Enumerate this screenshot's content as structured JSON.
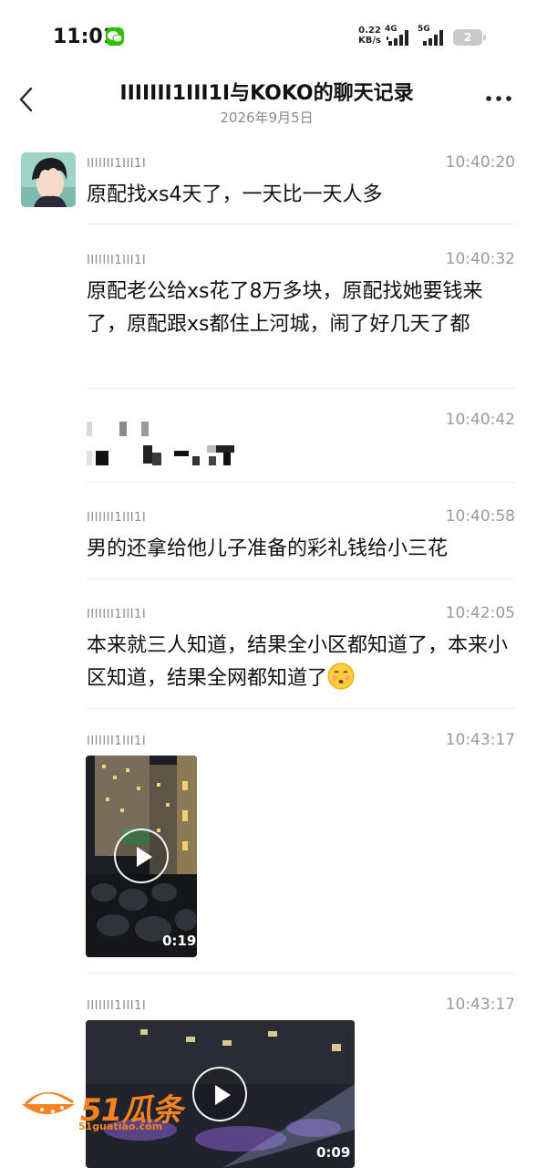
{
  "status_bar": {
    "time": "11:01",
    "net_rate_value": "0.22",
    "net_rate_unit": "KB/s",
    "net_type_1": "4G",
    "net_type_2": "5G",
    "battery": "2"
  },
  "header": {
    "title": "IIIIIII1III1I与KOKO的聊天记录",
    "date": "2026年9月5日"
  },
  "messages": [
    {
      "sender": "IIIIIII1III1I",
      "time": "10:40:20",
      "text": "原配找xs4天了，一天比一天人多"
    },
    {
      "sender": "IIIIIII1III1I",
      "time": "10:40:32",
      "text": "原配老公给xs花了8万多块，原配找她要钱来了，原配跟xs都住上河城，闹了好几天了都"
    },
    {
      "sender": "",
      "time": "10:40:42",
      "text": ""
    },
    {
      "sender": "IIIIIII1III1I",
      "time": "10:40:58",
      "text": "男的还拿给他儿子准备的彩礼钱给小三花"
    },
    {
      "sender": "IIIIIII1III1I",
      "time": "10:42:05",
      "text": "本来就三人知道，结果全小区都知道了，本来小区知道，结果全网都知道了"
    },
    {
      "sender": "IIIIIII1III1I",
      "time": "10:43:17",
      "video_duration": "0:19"
    },
    {
      "sender": "IIIIIII1III1I",
      "time": "10:43:17",
      "video_duration": "0:09"
    }
  ],
  "watermark": {
    "brand": "51瓜条",
    "url": "51guatiao.com"
  },
  "icons": {
    "back": "chevron-left-icon",
    "more": "more-dots-icon",
    "play": "play-icon",
    "emoji": "face-emoji-icon"
  },
  "colors": {
    "wechat_green": "#2dc100",
    "watermark_orange": "#f5821f",
    "meta_gray": "#8a8a8a"
  }
}
